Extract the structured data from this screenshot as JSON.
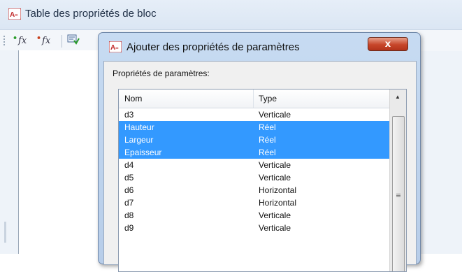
{
  "outer_window": {
    "title": "Table des propriétés de bloc",
    "toolbar": {
      "add_fx_label": "fx",
      "remove_fx_label": "fx"
    }
  },
  "dialog": {
    "title": "Ajouter des propriétés de paramètres",
    "close_glyph": "x",
    "section_label": "Propriétés de paramètres:",
    "columns": {
      "name": "Nom",
      "type": "Type"
    },
    "rows": [
      {
        "name": "d3",
        "type": "Verticale",
        "selected": false
      },
      {
        "name": "Hauteur",
        "type": "Réel",
        "selected": true
      },
      {
        "name": "Largeur",
        "type": "Réel",
        "selected": true
      },
      {
        "name": "Epaisseur",
        "type": "Réel",
        "selected": true
      },
      {
        "name": "d4",
        "type": "Verticale",
        "selected": false
      },
      {
        "name": "d5",
        "type": "Verticale",
        "selected": false
      },
      {
        "name": "d6",
        "type": "Horizontal",
        "selected": false
      },
      {
        "name": "d7",
        "type": "Horizontal",
        "selected": false
      },
      {
        "name": "d8",
        "type": "Verticale",
        "selected": false
      },
      {
        "name": "d9",
        "type": "Verticale",
        "selected": false
      }
    ]
  },
  "icons": {
    "app": "autocad-icon",
    "add_param": "add-parameter-icon",
    "remove_param": "remove-parameter-icon",
    "audit": "audit-icon"
  },
  "colors": {
    "selection": "#3399ff",
    "close_button": "#c7462a"
  }
}
